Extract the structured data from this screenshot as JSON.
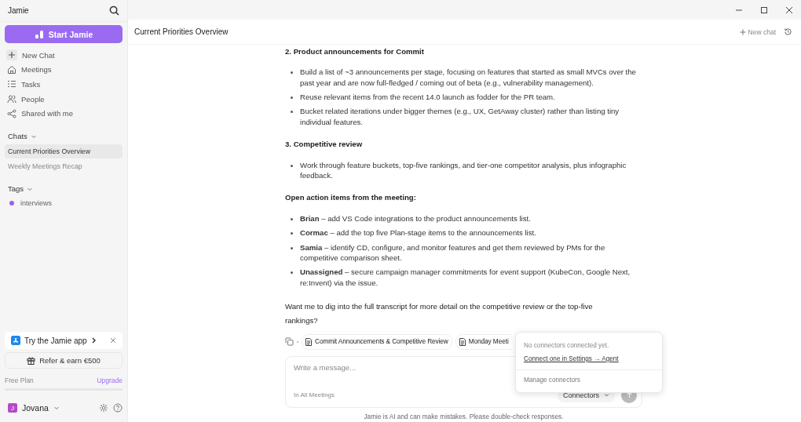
{
  "sidebar": {
    "app_name": "Jamie",
    "start_button": "Start Jamie",
    "nav": [
      {
        "label": "New Chat",
        "kind": "new"
      },
      {
        "label": "Meetings",
        "kind": "meetings"
      },
      {
        "label": "Tasks",
        "kind": "tasks"
      },
      {
        "label": "People",
        "kind": "people"
      },
      {
        "label": "Shared with me",
        "kind": "shared"
      }
    ],
    "chats_heading": "Chats",
    "chats": [
      {
        "label": "Current Priorities Overview",
        "selected": true
      },
      {
        "label": "Weekly Meetings Recap",
        "selected": false
      }
    ],
    "tags_heading": "Tags",
    "tags": [
      {
        "label": "interviews",
        "color": "#a35ee8"
      }
    ],
    "promo": "Try the Jamie app",
    "refer": "Refer & earn €500",
    "plan": "Free Plan",
    "upgrade": "Upgrade",
    "user": {
      "initial": "J",
      "name": "Jovana"
    }
  },
  "header": {
    "title": "Current Priorities Overview",
    "new_chat": "New chat"
  },
  "sections": [
    {
      "heading": "2. Product announcements for Commit",
      "bullets": [
        "Build a list of ~3 announcements per stage, focusing on features that started as small MVCs over the past year and are now full-fledged / coming out of beta (e.g., vulnerability management).",
        "Reuse relevant items from the recent 14.0 launch as fodder for the PR team.",
        "Bucket related iterations under bigger themes (e.g., UX, GetAway cluster) rather than listing tiny individual features."
      ]
    },
    {
      "heading": "3. Competitive review",
      "bullets": [
        "Work through feature buckets, top-five rankings, and tier-one competitor analysis, plus infographic feedback."
      ]
    },
    {
      "heading": "Open action items from the meeting:",
      "bullets": [
        "**Brian** – add VS Code integrations to the product announcements list.",
        "**Cormac** – add the top five Plan-stage items to the announcements list.",
        "**Samia** – identify CD, configure, and monitor features and get them reviewed by PMs for the competitive comparison sheet.",
        "**Unassigned** – secure campaign manager commitments for event support (KubeCon, Google Next, re:Invent) via the issue."
      ]
    }
  ],
  "closing": "Want me to dig into the full transcript for more detail on the competitive review or the top-five rankings?",
  "sources": [
    "Commit Announcements & Competitive Review",
    "Monday Meeti"
  ],
  "composer": {
    "placeholder": "Write a message...",
    "scope": "In All Meetings",
    "connectors": "Connectors"
  },
  "popover": {
    "note": "No connectors connected yet.",
    "link": "Connect one in Settings → Agent",
    "manage": "Manage connectors"
  },
  "disclaimer": "Jamie is AI and can make mistakes. Please double-check responses."
}
